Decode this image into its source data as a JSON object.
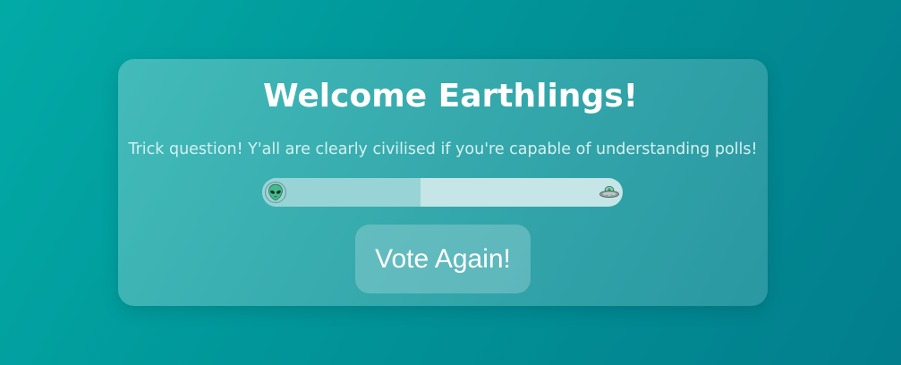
{
  "card": {
    "title": "Welcome Earthlings!",
    "subtitle": "Trick question! Y'all are clearly civilised if you're capable of understanding polls!"
  },
  "poll": {
    "left_icon": "alien-icon",
    "right_icon": "ufo-icon",
    "left_share": 0.44,
    "colors": {
      "left_fill": "#98d4d6",
      "right_fill": "#c5e5e7"
    }
  },
  "vote_button": {
    "label": "Vote Again!"
  }
}
